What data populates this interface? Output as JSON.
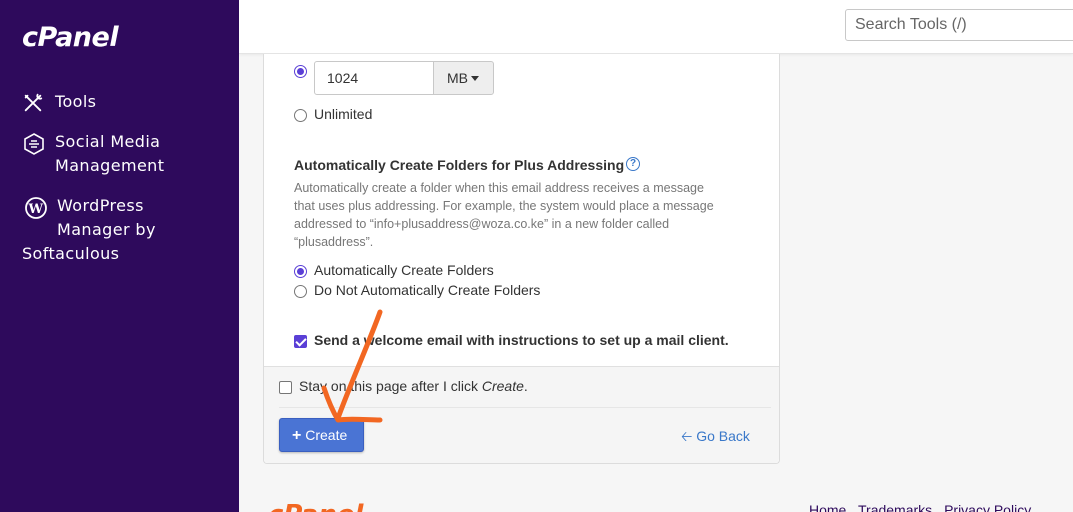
{
  "sidebar": {
    "logo": "cPanel",
    "items": [
      {
        "label": "Tools",
        "icon": "tools-icon"
      },
      {
        "label_line1": "Social Media",
        "label_line2": "Management",
        "icon": "social-media-icon"
      },
      {
        "label_line1": "WordPress",
        "label_line2": "Manager by",
        "label_line3": "Softaculous",
        "icon": "wordpress-icon"
      }
    ]
  },
  "header": {
    "search_placeholder": "Search Tools (/)"
  },
  "quota": {
    "value": "1024",
    "unit": "MB",
    "selected": "limited",
    "unlimited_label": "Unlimited"
  },
  "plus_addressing": {
    "heading": "Automatically Create Folders for Plus Addressing",
    "description_lines": [
      "Automatically create a folder when this email address receives a message",
      "that uses plus addressing. For example, the system would place a message",
      "addressed to “info+plusaddress@woza.co.ke” in a new folder called",
      "“plusaddress”."
    ],
    "option_auto": "Automatically Create Folders",
    "option_no_auto": "Do Not Automatically Create Folders",
    "selected": "auto"
  },
  "welcome_email": {
    "label": "Send a welcome email with instructions to set up a mail client.",
    "checked": true
  },
  "stay_on_page": {
    "label_prefix": "Stay on this page after I click ",
    "label_emph": "Create",
    "label_suffix": ".",
    "checked": false
  },
  "actions": {
    "create_label": "Create",
    "go_back_label": "Go Back"
  },
  "footer": {
    "logo": "cPanel",
    "links": [
      "Home",
      "Trademarks",
      "Privacy Policy"
    ]
  },
  "colors": {
    "sidebar_bg": "#2e0a5c",
    "accent_purple": "#5a3fd6",
    "create_button": "#4a74d4",
    "link_blue": "#3a78c9",
    "annotation_orange": "#f26722"
  }
}
